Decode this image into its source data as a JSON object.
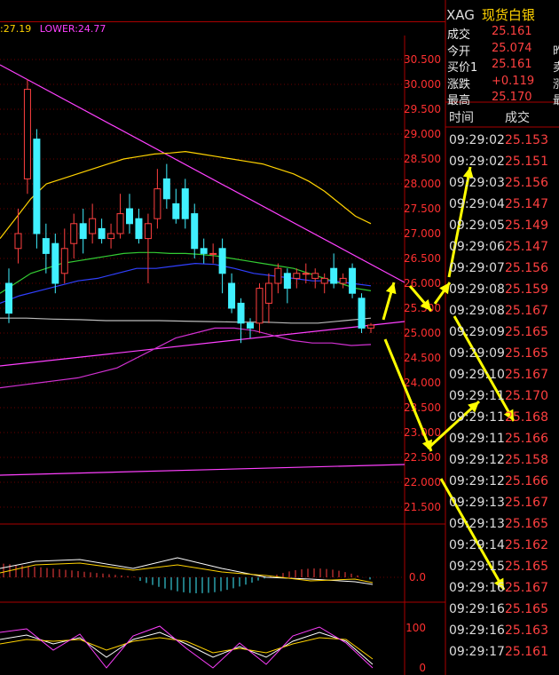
{
  "legend": {
    "upper": ":27.19",
    "lower": "LOWER:24.77"
  },
  "quote": {
    "symbol": "XAG",
    "name": "现货白银",
    "rows": [
      {
        "label": "成交",
        "value": "25.161",
        "tail": ""
      },
      {
        "label": "今开",
        "value": "25.074",
        "tail": "昨"
      },
      {
        "label": "买价1",
        "value": "25.161",
        "tail": "卖"
      },
      {
        "label": "涨跌",
        "value": "+0.119",
        "tail": "涨"
      },
      {
        "label": "最高",
        "value": "25.170",
        "tail": "最"
      }
    ]
  },
  "ticks": {
    "col_time": "时间",
    "col_price": "成交",
    "rows": [
      {
        "time": "09:29:02",
        "price": "25.153"
      },
      {
        "time": "09:29:02",
        "price": "25.151"
      },
      {
        "time": "09:29:03",
        "price": "25.156"
      },
      {
        "time": "09:29:04",
        "price": "25.147"
      },
      {
        "time": "09:29:05",
        "price": "25.149"
      },
      {
        "time": "09:29:06",
        "price": "25.147"
      },
      {
        "time": "09:29:07",
        "price": "25.156"
      },
      {
        "time": "09:29:08",
        "price": "25.159"
      },
      {
        "time": "09:29:08",
        "price": "25.167"
      },
      {
        "time": "09:29:09",
        "price": "25.165"
      },
      {
        "time": "09:29:09",
        "price": "25.165"
      },
      {
        "time": "09:29:10",
        "price": "25.167"
      },
      {
        "time": "09:29:11",
        "price": "25.170"
      },
      {
        "time": "09:29:11",
        "price": "25.168"
      },
      {
        "time": "09:29:11",
        "price": "25.166"
      },
      {
        "time": "09:29:12",
        "price": "25.158"
      },
      {
        "time": "09:29:12",
        "price": "25.166"
      },
      {
        "time": "09:29:13",
        "price": "25.167"
      },
      {
        "time": "09:29:13",
        "price": "25.165"
      },
      {
        "time": "09:29:14",
        "price": "25.162"
      },
      {
        "time": "09:29:15",
        "price": "25.165"
      },
      {
        "time": "09:29:16",
        "price": "25.167"
      },
      {
        "time": "09:29:16",
        "price": "25.165"
      },
      {
        "time": "09:29:16",
        "price": "25.163"
      },
      {
        "time": "09:29:17",
        "price": "25.161"
      }
    ]
  },
  "chart_data": {
    "type": "candlestick",
    "y_ticks": [
      "30.500",
      "30.000",
      "29.500",
      "29.000",
      "28.500",
      "28.000",
      "27.500",
      "27.000",
      "26.500",
      "26.000",
      "25.500",
      "25.000",
      "24.500",
      "24.000",
      "23.500",
      "23.000",
      "22.500",
      "22.000",
      "21.500"
    ],
    "ylim": [
      21.3,
      30.9
    ],
    "candles": [
      {
        "o": 26.0,
        "c": 25.4,
        "h": 26.3,
        "l": 25.2
      },
      {
        "o": 26.7,
        "c": 27.0,
        "h": 27.5,
        "l": 26.4
      },
      {
        "o": 28.1,
        "c": 29.9,
        "h": 30.1,
        "l": 27.8
      },
      {
        "o": 28.9,
        "c": 27.0,
        "h": 29.1,
        "l": 26.7
      },
      {
        "o": 26.9,
        "c": 26.6,
        "h": 27.2,
        "l": 26.2
      },
      {
        "o": 26.8,
        "c": 26.0,
        "h": 27.0,
        "l": 25.8
      },
      {
        "o": 26.2,
        "c": 26.7,
        "h": 27.1,
        "l": 26.0
      },
      {
        "o": 26.8,
        "c": 27.2,
        "h": 27.4,
        "l": 26.5
      },
      {
        "o": 27.2,
        "c": 26.9,
        "h": 27.5,
        "l": 26.6
      },
      {
        "o": 27.0,
        "c": 27.3,
        "h": 27.6,
        "l": 26.8
      },
      {
        "o": 27.1,
        "c": 26.9,
        "h": 27.3,
        "l": 26.8
      },
      {
        "o": 26.9,
        "c": 27.0,
        "h": 27.2,
        "l": 26.7
      },
      {
        "o": 27.0,
        "c": 27.4,
        "h": 27.8,
        "l": 26.9
      },
      {
        "o": 27.5,
        "c": 27.2,
        "h": 27.8,
        "l": 27.0
      },
      {
        "o": 27.3,
        "c": 26.9,
        "h": 27.5,
        "l": 26.8
      },
      {
        "o": 26.9,
        "c": 27.2,
        "h": 27.4,
        "l": 26.0
      },
      {
        "o": 27.3,
        "c": 27.9,
        "h": 28.3,
        "l": 27.1
      },
      {
        "o": 28.1,
        "c": 27.7,
        "h": 28.4,
        "l": 27.5
      },
      {
        "o": 27.6,
        "c": 27.3,
        "h": 27.9,
        "l": 27.2
      },
      {
        "o": 27.9,
        "c": 27.3,
        "h": 28.1,
        "l": 27.1
      },
      {
        "o": 27.4,
        "c": 26.7,
        "h": 27.6,
        "l": 26.5
      },
      {
        "o": 26.7,
        "c": 26.6,
        "h": 26.9,
        "l": 26.4
      },
      {
        "o": 26.6,
        "c": 26.6,
        "h": 26.8,
        "l": 26.4
      },
      {
        "o": 26.7,
        "c": 26.2,
        "h": 26.9,
        "l": 25.8
      },
      {
        "o": 26.0,
        "c": 25.5,
        "h": 26.2,
        "l": 25.4
      },
      {
        "o": 25.6,
        "c": 25.2,
        "h": 25.7,
        "l": 24.8
      },
      {
        "o": 25.2,
        "c": 25.1,
        "h": 25.3,
        "l": 24.9
      },
      {
        "o": 25.2,
        "c": 25.9,
        "h": 26.0,
        "l": 25.0
      },
      {
        "o": 25.6,
        "c": 26.0,
        "h": 26.2,
        "l": 25.2
      },
      {
        "o": 26.0,
        "c": 26.3,
        "h": 26.4,
        "l": 25.8
      },
      {
        "o": 26.2,
        "c": 25.9,
        "h": 26.3,
        "l": 25.6
      },
      {
        "o": 26.1,
        "c": 26.2,
        "h": 26.3,
        "l": 25.9
      },
      {
        "o": 26.2,
        "c": 26.2,
        "h": 26.4,
        "l": 26.0
      },
      {
        "o": 26.1,
        "c": 26.2,
        "h": 26.3,
        "l": 25.9
      },
      {
        "o": 26.0,
        "c": 26.1,
        "h": 26.2,
        "l": 25.8
      },
      {
        "o": 26.3,
        "c": 26.0,
        "h": 26.6,
        "l": 25.9
      },
      {
        "o": 26.0,
        "c": 26.1,
        "h": 26.2,
        "l": 25.9
      },
      {
        "o": 26.3,
        "c": 25.8,
        "h": 26.4,
        "l": 25.7
      },
      {
        "o": 25.7,
        "c": 25.1,
        "h": 25.8,
        "l": 25.0
      },
      {
        "o": 25.1,
        "c": 25.16,
        "h": 25.2,
        "l": 25.0
      }
    ],
    "upper_band": [
      26.9,
      27.3,
      27.7,
      28.0,
      28.1,
      28.2,
      28.3,
      28.4,
      28.5,
      28.55,
      28.6,
      28.62,
      28.65,
      28.6,
      28.55,
      28.5,
      28.45,
      28.4,
      28.3,
      28.2,
      28.05,
      27.85,
      27.6,
      27.35,
      27.2
    ],
    "middle_band": [
      25.8,
      26.0,
      26.2,
      26.3,
      26.4,
      26.45,
      26.5,
      26.55,
      26.6,
      26.62,
      26.62,
      26.6,
      26.6,
      26.58,
      26.55,
      26.5,
      26.45,
      26.4,
      26.35,
      26.3,
      26.2,
      26.1,
      26.0,
      25.9,
      25.85
    ],
    "lower_band": [
      23.9,
      23.95,
      24.0,
      24.05,
      24.1,
      24.2,
      24.3,
      24.5,
      24.7,
      24.9,
      25.0,
      25.1,
      25.1,
      25.05,
      24.95,
      24.85,
      24.8,
      24.8,
      24.75,
      24.77
    ]
  }
}
